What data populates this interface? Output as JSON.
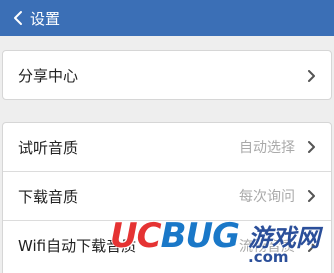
{
  "header": {
    "title": "设置",
    "back_icon": "chevron-left-icon",
    "background_color": "#3b6fb6"
  },
  "groups": [
    {
      "rows": [
        {
          "label": "分享中心",
          "value": ""
        }
      ]
    },
    {
      "rows": [
        {
          "label": "试听音质",
          "value": "自动选择"
        },
        {
          "label": "下载音质",
          "value": "每次询问"
        },
        {
          "label": "Wifi自动下载音质",
          "value": "流畅音质"
        }
      ]
    }
  ],
  "watermark": {
    "brand_prefix": "UC",
    "brand_suffix": "BUG",
    "site_name": "游戏网",
    "domain": ".com"
  },
  "icons": {
    "row_arrow": "chevron-right-icon"
  }
}
